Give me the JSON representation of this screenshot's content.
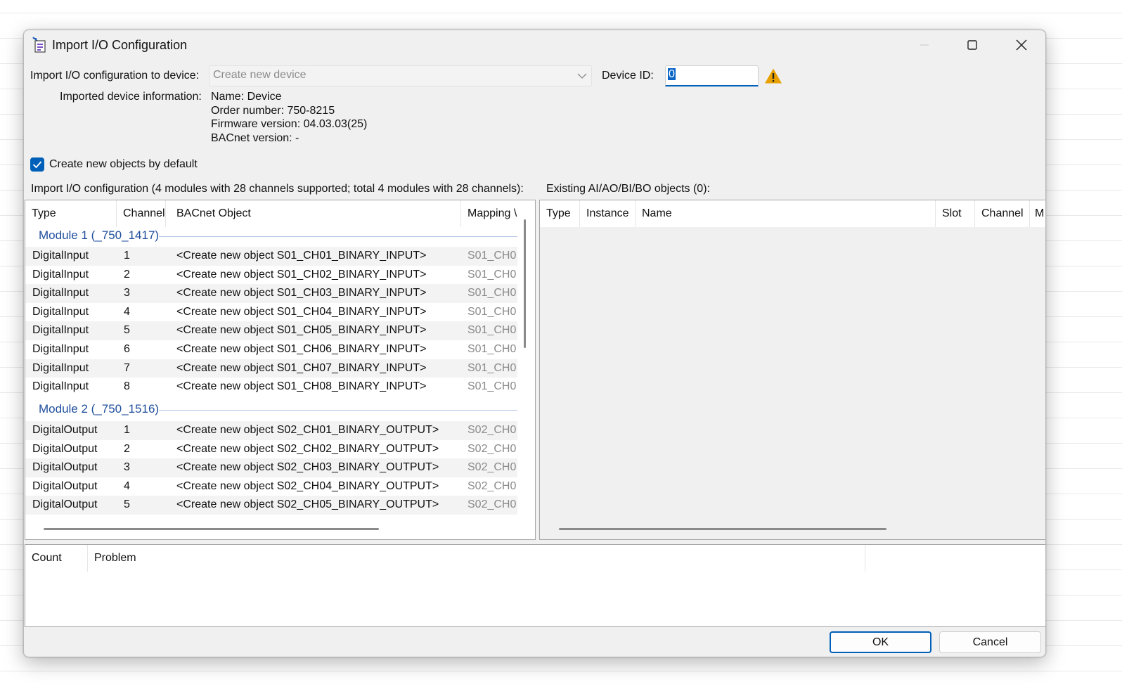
{
  "window": {
    "title": "Import I/O Configuration",
    "minimize_label": "—"
  },
  "form": {
    "target_label": "Import I/O configuration to device:",
    "target_value": "Create new device",
    "device_id_label": "Device ID:",
    "device_id_value": "0",
    "device_info_label": "Imported device information:",
    "device_info": {
      "name": "Name: Device",
      "order": "Order number: 750-8215",
      "firmware": "Firmware version: 04.03.03(25)",
      "bacnet": "BACnet version: -"
    },
    "checkbox_label": "Create new objects by default",
    "checkbox_checked": true
  },
  "import_table": {
    "caption": "Import I/O configuration (4 modules with 28 channels supported; total 4 modules with 28 channels):",
    "headers": [
      "Type",
      "Channel",
      "BACnet Object",
      "Mapping \\"
    ],
    "groups": [
      {
        "label": "Module 1 (_750_1417)",
        "rows": [
          [
            "DigitalInput",
            "1",
            "<Create new object S01_CH01_BINARY_INPUT>",
            "S01_CH0"
          ],
          [
            "DigitalInput",
            "2",
            "<Create new object S01_CH02_BINARY_INPUT>",
            "S01_CH0"
          ],
          [
            "DigitalInput",
            "3",
            "<Create new object S01_CH03_BINARY_INPUT>",
            "S01_CH0"
          ],
          [
            "DigitalInput",
            "4",
            "<Create new object S01_CH04_BINARY_INPUT>",
            "S01_CH0"
          ],
          [
            "DigitalInput",
            "5",
            "<Create new object S01_CH05_BINARY_INPUT>",
            "S01_CH0"
          ],
          [
            "DigitalInput",
            "6",
            "<Create new object S01_CH06_BINARY_INPUT>",
            "S01_CH0"
          ],
          [
            "DigitalInput",
            "7",
            "<Create new object S01_CH07_BINARY_INPUT>",
            "S01_CH0"
          ],
          [
            "DigitalInput",
            "8",
            "<Create new object S01_CH08_BINARY_INPUT>",
            "S01_CH0"
          ]
        ]
      },
      {
        "label": "Module 2 (_750_1516)",
        "rows": [
          [
            "DigitalOutput",
            "1",
            "<Create new object S02_CH01_BINARY_OUTPUT>",
            "S02_CH0"
          ],
          [
            "DigitalOutput",
            "2",
            "<Create new object S02_CH02_BINARY_OUTPUT>",
            "S02_CH0"
          ],
          [
            "DigitalOutput",
            "3",
            "<Create new object S02_CH03_BINARY_OUTPUT>",
            "S02_CH0"
          ],
          [
            "DigitalOutput",
            "4",
            "<Create new object S02_CH04_BINARY_OUTPUT>",
            "S02_CH0"
          ],
          [
            "DigitalOutput",
            "5",
            "<Create new object S02_CH05_BINARY_OUTPUT>",
            "S02_CH0"
          ]
        ]
      }
    ]
  },
  "existing_table": {
    "caption": "Existing AI/AO/BI/BO objects (0):",
    "headers": [
      "Type",
      "Instance",
      "Name",
      "Slot",
      "Channel",
      "M"
    ]
  },
  "problems_table": {
    "headers": [
      "Count",
      "Problem"
    ]
  },
  "buttons": {
    "ok": "OK",
    "cancel": "Cancel"
  },
  "colors": {
    "accent": "#005fb8",
    "group_header": "#1f4e9c",
    "warning": "#e8a100"
  },
  "icons": {
    "app": "import-config-icon",
    "warning": "warning-icon",
    "dropdown": "chevron-down-icon",
    "check": "checkmark-icon"
  }
}
